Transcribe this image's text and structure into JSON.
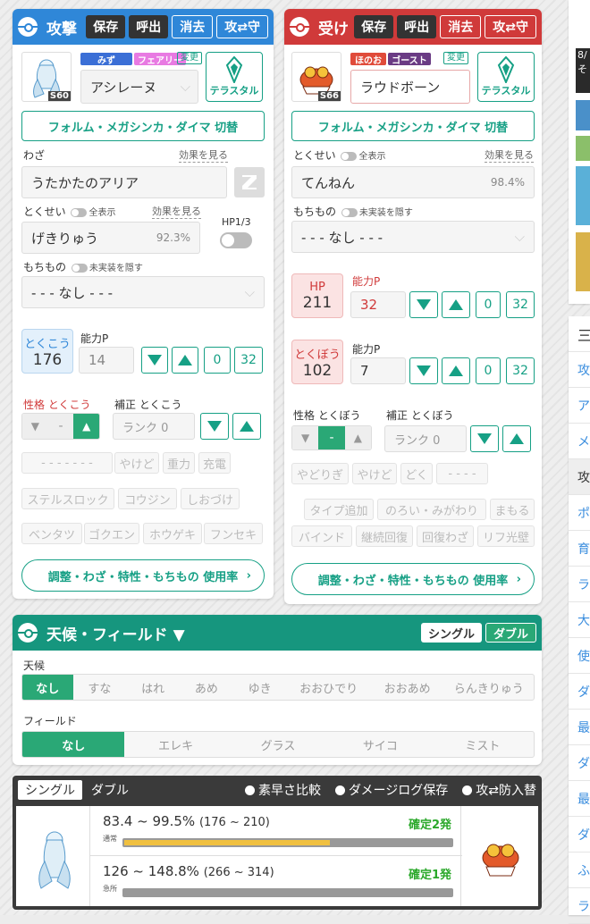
{
  "attack": {
    "title": "攻撃",
    "save": "保存",
    "load": "呼出",
    "clear": "消去",
    "swap": "攻⇄守",
    "pokemon": "アシレーヌ",
    "level": "S60",
    "type1": "みず",
    "type2": "フェアリー",
    "change": "変更",
    "tera": "テラスタル",
    "form_toggle": "フォルム・メガシンカ・ダイマ 切替",
    "move_label": "わざ",
    "move_effect": "効果を見る",
    "move": "うたかたのアリア",
    "ability_label": "とくせい",
    "show_all": "全表示",
    "ability_effect": "効果を見る",
    "ability": "げきりゅう",
    "ability_rate": "92.3%",
    "hp_label": "HP1/3",
    "item_label": "もちもの",
    "hide_unimpl": "未実装を隠す",
    "item": "- - - なし - - -",
    "stat_name": "とくこう",
    "stat_value": "176",
    "ability_p": "能力P",
    "ap_value": "14",
    "rank_zero": "0",
    "rank_max": "32",
    "nature_label": "性格",
    "nature_stat": "とくこう",
    "nature_mid": "-",
    "mod_label": "補正",
    "mod_stat": "とくこう",
    "rank_placeholder": "ランク 0",
    "conditions_row1": [
      "- - - - - - -",
      "やけど",
      "重力",
      "充電"
    ],
    "conditions_row2": [
      "ステルスロック",
      "コウジン",
      "しおづけ"
    ],
    "conditions_row3": [
      "ベンタツ",
      "ゴクエン",
      "ホウゲキ",
      "フンセキ"
    ],
    "usage_link": "調整・わざ・特性・もちもの 使用率"
  },
  "defense": {
    "title": "受け",
    "save": "保存",
    "load": "呼出",
    "clear": "消去",
    "swap": "攻⇄守",
    "pokemon": "ラウドボーン",
    "level": "S66",
    "type1": "ほのお",
    "type2": "ゴースト",
    "change": "変更",
    "tera": "テラスタル",
    "form_toggle": "フォルム・メガシンカ・ダイマ 切替",
    "ability_label": "とくせい",
    "show_all": "全表示",
    "ability_effect": "効果を見る",
    "ability": "てんねん",
    "ability_rate": "98.4%",
    "item_label": "もちもの",
    "hide_unimpl": "未実装を隠す",
    "item": "- - - なし - - -",
    "hp_name": "HP",
    "hp_value": "211",
    "ability_p": "能力P",
    "hp_ap": "32",
    "stat_name": "とくぼう",
    "stat_value": "102",
    "ap_value": "7",
    "rank_zero": "0",
    "rank_max": "32",
    "nature_label": "性格",
    "nature_stat": "とくぼう",
    "nature_mid": "-",
    "mod_label": "補正",
    "mod_stat": "とくぼう",
    "rank_placeholder": "ランク 0",
    "conditions_row1": [
      "やどりぎ",
      "やけど",
      "どく",
      "- - - -"
    ],
    "conditions_row2": [
      "タイプ追加",
      "のろい・みがわり",
      "まもる"
    ],
    "conditions_row3": [
      "バインド",
      "継続回復",
      "回復わざ",
      "リフ光壁"
    ],
    "usage_link": "調整・わざ・特性・もちもの 使用率"
  },
  "field": {
    "title": "天候・フィールド ▼",
    "single": "シングル",
    "double": "ダブル",
    "weather_label": "天候",
    "weather": [
      "なし",
      "すな",
      "はれ",
      "あめ",
      "ゆき",
      "おおひでり",
      "おおあめ",
      "らんきりゅう"
    ],
    "field_label": "フィールド",
    "fields": [
      "なし",
      "エレキ",
      "グラス",
      "サイコ",
      "ミスト"
    ]
  },
  "result": {
    "single": "シングル",
    "double": "ダブル",
    "speed": "素早さ比較",
    "log": "ダメージログ保存",
    "swap": "攻⇄防入替",
    "normal_range": "83.4 ~ 99.5%",
    "normal_dmg": "(176 ~ 210)",
    "normal_label": "通常",
    "normal_ko": "確定2発",
    "crit_range": "126 ~ 148.8%",
    "crit_dmg": "(266 ~ 314)",
    "crit_label": "急所",
    "crit_ko": "確定1発"
  },
  "normal_bar": {
    "from": 83.4,
    "to": 99.5
  },
  "sidebar": {
    "ad_text": [
      "8/",
      "そ"
    ],
    "menu_icon": "三",
    "items": [
      "攻",
      "ア",
      "メ",
      "攻",
      "ポ",
      "育",
      "ラ",
      "大",
      "使",
      "ダ",
      "最",
      "ダ",
      "最",
      "ダ",
      "ふ",
      "ラ"
    ]
  },
  "colors": {
    "attack": "#2f87d8",
    "defense": "#d03a3a",
    "teal": "#16a085",
    "field": "#16967e",
    "dark": "#333333"
  }
}
